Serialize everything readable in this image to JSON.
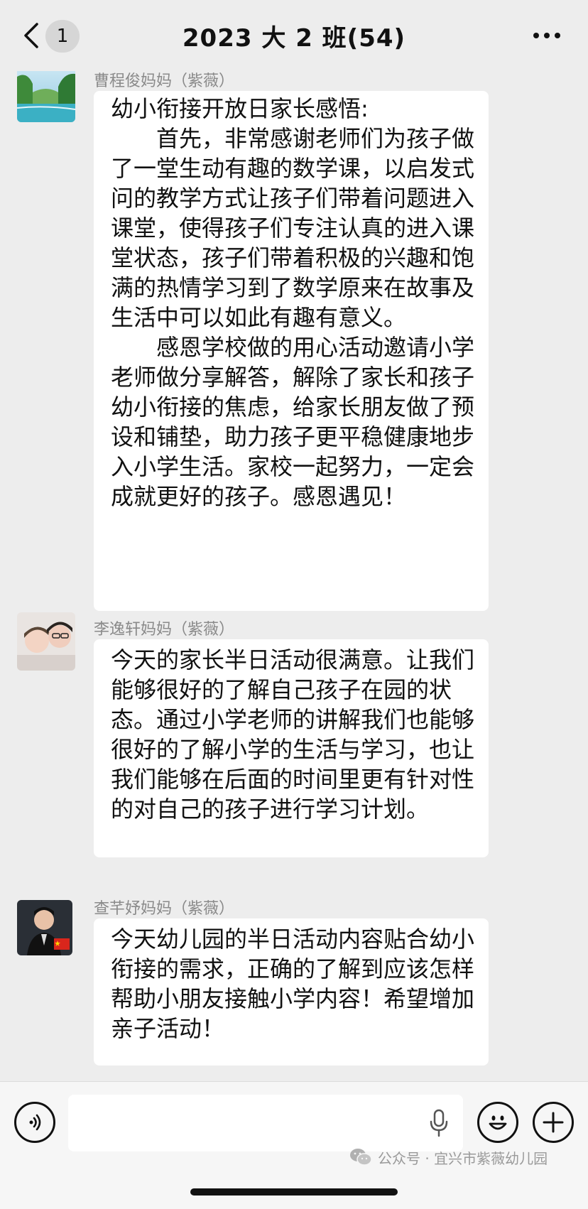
{
  "header": {
    "title": "2023  大 2 班(54)",
    "unread_count": "1",
    "back_icon": "chevron-left-icon",
    "more_icon": "more-dots-icon"
  },
  "messages": [
    {
      "sender": "曹程俊妈妈（紫薇）",
      "avatar": "landscape-avatar",
      "text": "幼小衔接开放日家长感悟:\n　　首先，非常感谢老师们为孩子做了一堂生动有趣的数学课，以启发式问的教学方式让孩子们带着问题进入课堂，使得孩子们专注认真的进入课堂状态，孩子们带着积极的兴趣和饱满的热情学习到了数学原来在故事及生活中可以如此有趣有意义。\n　　感恩学校做的用心活动邀请小学老师做分享解答，解除了家长和孩子幼小衔接的焦虑，给家长朋友做了预设和铺垫，助力孩子更平稳健康地步入小学生活。家校一起努力，一定会成就更好的孩子。感恩遇见！"
    },
    {
      "sender": "李逸轩妈妈（紫薇）",
      "avatar": "mother-child-avatar",
      "text": "今天的家长半日活动很满意。让我们能够很好的了解自己孩子在园的状态。通过小学老师的讲解我们也能够很好的了解小学的生活与学习，也让我们能够在后面的时间里更有针对性的对自己的孩子进行学习计划。"
    },
    {
      "sender": "查芊妤妈妈（紫薇）",
      "avatar": "person-flag-avatar",
      "text": "今天幼儿园的半日活动内容贴合幼小衔接的需求，正确的了解到应该怎样帮助小朋友接触小学内容！希望增加亲子活动！"
    }
  ],
  "input_bar": {
    "voice_icon": "voice-icon",
    "mic_icon": "mic-icon",
    "emoji_icon": "emoji-icon",
    "plus_icon": "plus-icon",
    "input_value": ""
  },
  "watermark": {
    "icon": "wechat-icon",
    "text": "公众号 · 宜兴市紫薇幼儿园"
  },
  "colors": {
    "background": "#ededed",
    "bubble": "#ffffff",
    "sender_text": "#8a8a8a"
  }
}
